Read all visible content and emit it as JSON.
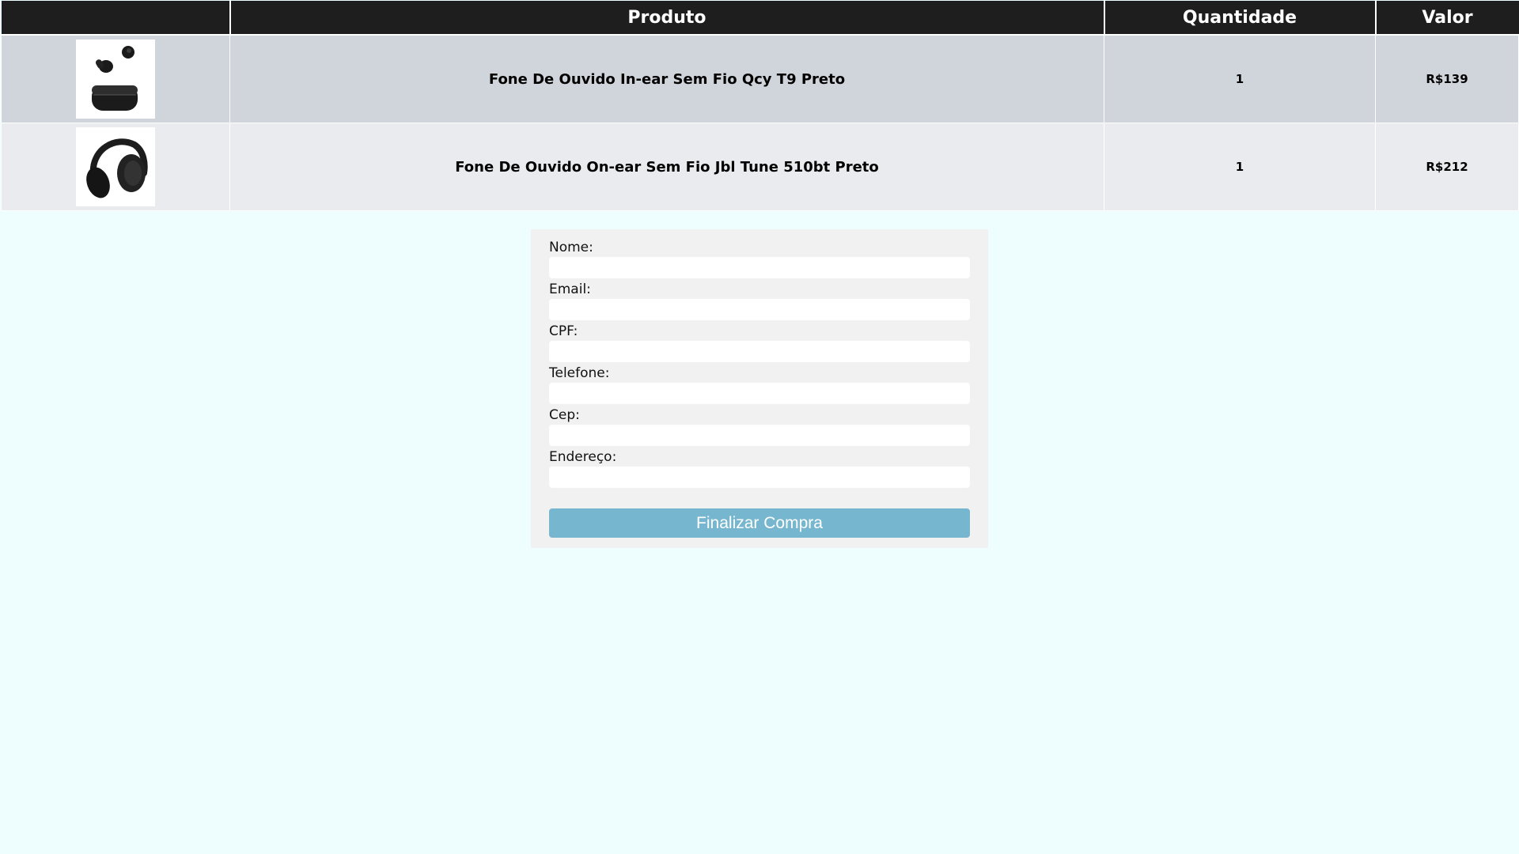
{
  "table": {
    "headers": {
      "image": "",
      "product": "Produto",
      "quantity": "Quantidade",
      "price": "Valor"
    },
    "rows": [
      {
        "icon": "earbuds-product-image",
        "name": "Fone De Ouvido In-ear Sem Fio Qcy T9 Preto",
        "quantity": "1",
        "price": "R$139"
      },
      {
        "icon": "headphones-product-image",
        "name": "Fone De Ouvido On-ear Sem Fio Jbl Tune 510bt Preto",
        "quantity": "1",
        "price": "R$212"
      }
    ]
  },
  "form": {
    "fields": [
      {
        "label": "Nome:",
        "value": ""
      },
      {
        "label": "Email:",
        "value": ""
      },
      {
        "label": "CPF:",
        "value": ""
      },
      {
        "label": "Telefone:",
        "value": ""
      },
      {
        "label": "Cep:",
        "value": ""
      },
      {
        "label": "Endereço:",
        "value": ""
      }
    ],
    "submit_label": "Finalizar Compra"
  },
  "colors": {
    "page_background": "#eefefe",
    "header_background": "#1e1e1e",
    "row_odd": "#d0d5db",
    "row_even": "#e9ebee",
    "form_background": "#f1f1f1",
    "button": "#76b6cf"
  }
}
